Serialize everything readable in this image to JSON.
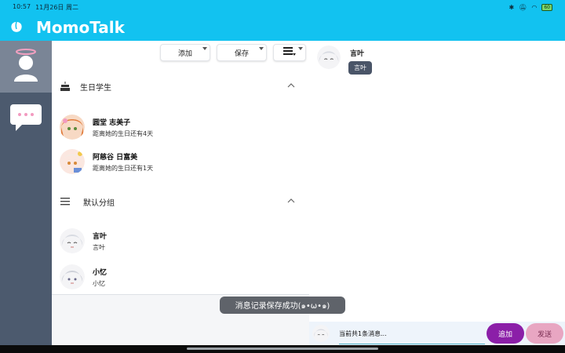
{
  "status_bar": {
    "time": "10:57",
    "date": "11月26日 周二",
    "battery": "60"
  },
  "app": {
    "title": "MomoTalk",
    "logo_icon": "peach-icon",
    "brand_color": "#12c2f0"
  },
  "rail": {
    "profile_icon": "avatar-halo-icon",
    "chat_icon": "chat-bubble-icon"
  },
  "toolbar": {
    "add_label": "添加",
    "save_label": "保存",
    "menu_icon": "list-menu-icon"
  },
  "birthday_section": {
    "title": "生日学生",
    "icon": "cake-icon",
    "contacts": [
      {
        "name": "圆堂 志美子",
        "subtitle": "距离她的生日还有4天"
      },
      {
        "name": "阿慈谷 日富美",
        "subtitle": "距离她的生日还有1天"
      }
    ]
  },
  "default_group": {
    "title": "默认分组",
    "icon": "hamburger-icon",
    "contacts": [
      {
        "name": "言叶",
        "subtitle": "言叶"
      },
      {
        "name": "小忆",
        "subtitle": "小忆"
      }
    ]
  },
  "chat": {
    "sender": "言叶",
    "message": "言叶"
  },
  "toast": "消息记录保存成功(๑•ω•๑)",
  "bottom": {
    "count_text": "当前共1条消息...",
    "add_label": "追加",
    "send_label": "发送",
    "add_color": "#8b1fa8",
    "send_color": "#e8a6c2"
  }
}
